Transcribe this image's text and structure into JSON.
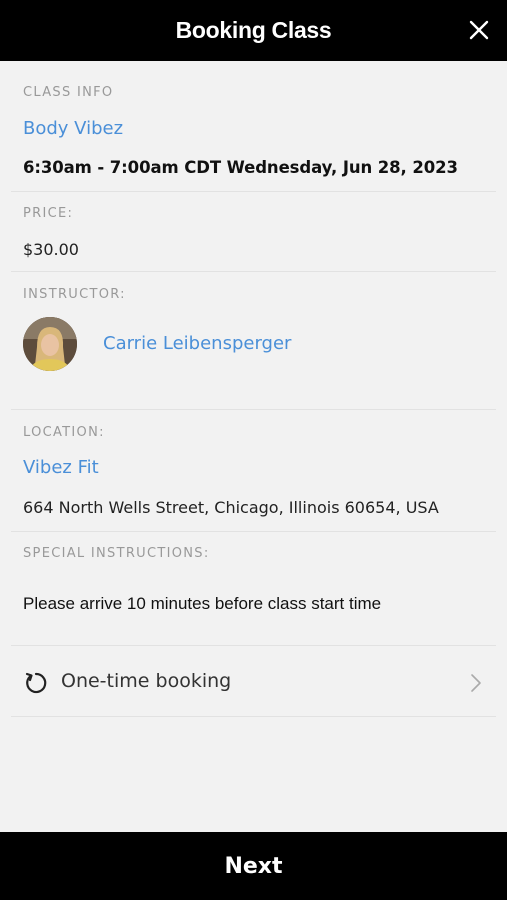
{
  "header": {
    "title": "Booking Class"
  },
  "class_info": {
    "label": "CLASS INFO",
    "class_name": "Body Vibez",
    "datetime": "6:30am - 7:00am CDT Wednesday, Jun 28, 2023"
  },
  "price": {
    "label": "PRICE:",
    "value": "$30.00"
  },
  "instructor": {
    "label": "INSTRUCTOR:",
    "name": "Carrie Leibensperger"
  },
  "location": {
    "label": "LOCATION:",
    "name": "Vibez Fit",
    "address": "664 North Wells Street, Chicago, Illinois 60654, USA"
  },
  "special_instructions": {
    "label": "SPECIAL INSTRUCTIONS:",
    "text": "Please arrive 10 minutes before class start time"
  },
  "booking": {
    "label": "One-time booking"
  },
  "footer": {
    "next_label": "Next"
  },
  "colors": {
    "accent": "#4a8fd8",
    "header_bg": "#000000",
    "page_bg": "#f2f2f2"
  },
  "icons": [
    "close-icon",
    "refresh-icon",
    "chevron-right-icon"
  ]
}
